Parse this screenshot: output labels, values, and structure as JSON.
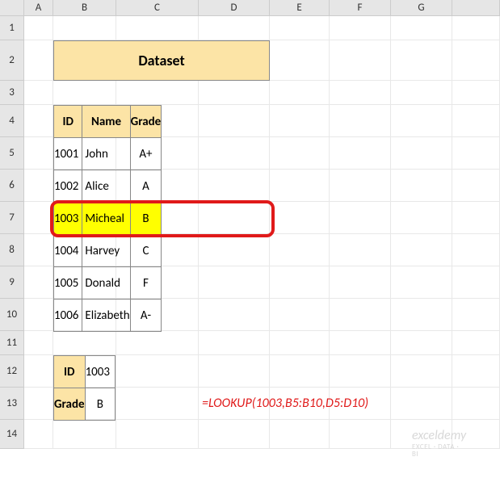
{
  "columns": [
    "A",
    "B",
    "C",
    "D",
    "E",
    "F",
    "G",
    ""
  ],
  "rows": [
    "1",
    "2",
    "3",
    "4",
    "5",
    "6",
    "7",
    "8",
    "9",
    "10",
    "11",
    "12",
    "13",
    "14"
  ],
  "title": "Dataset",
  "headers": {
    "id": "ID",
    "name": "Name",
    "grade": "Grade"
  },
  "data_rows": [
    {
      "id": "1001",
      "name": "John",
      "grade": "A+"
    },
    {
      "id": "1002",
      "name": "Alice",
      "grade": "A"
    },
    {
      "id": "1003",
      "name": "Micheal",
      "grade": "B"
    },
    {
      "id": "1004",
      "name": "Harvey",
      "grade": "C"
    },
    {
      "id": "1005",
      "name": "Donald",
      "grade": "F"
    },
    {
      "id": "1006",
      "name": "Elizabeth",
      "grade": "A-"
    }
  ],
  "highlight_index": 2,
  "lookup": {
    "id_label": "ID",
    "id_value": "1003",
    "grade_label": "Grade",
    "grade_value": "B"
  },
  "formula": "=LOOKUP(1003,B5:B10,D5:D10)",
  "watermark": {
    "main": "exceldemy",
    "sub": "EXCEL · DATA · BI"
  },
  "colors": {
    "header_bg": "#fce4a6",
    "highlight": "#ffff00",
    "accent": "#e01a1a"
  }
}
